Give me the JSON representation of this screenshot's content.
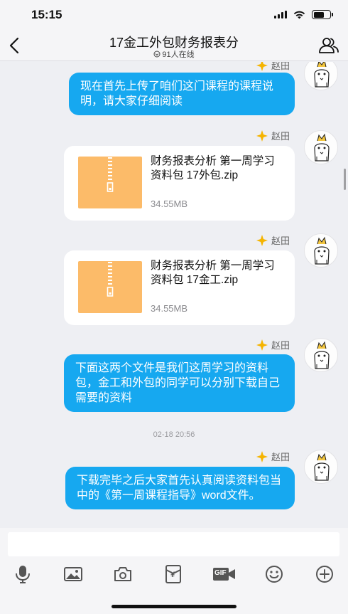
{
  "status": {
    "time": "15:15"
  },
  "header": {
    "title": "17金工外包财务报表分",
    "online": "91人在线"
  },
  "messages": [
    {
      "type": "text",
      "sender": "赵田",
      "text": "现在首先上传了咱们这门课程的课程说明，请大家仔细阅读"
    },
    {
      "type": "file",
      "sender": "赵田",
      "file_name": "财务报表分析 第一周学习资料包 17外包.zip",
      "file_size": "34.55MB"
    },
    {
      "type": "file",
      "sender": "赵田",
      "file_name": "财务报表分析 第一周学习资料包 17金工.zip",
      "file_size": "34.55MB"
    },
    {
      "type": "text",
      "sender": "赵田",
      "text": "下面这两个文件是我们这周学习的资料包，金工和外包的同学可以分别下载自己需要的资料"
    },
    {
      "type": "timestamp",
      "text": "02-18 20:56"
    },
    {
      "type": "text",
      "sender": "赵田",
      "text": "下载完毕之后大家首先认真阅读资料包当中的《第一周课程指导》word文件。"
    }
  ],
  "input": {
    "value": "",
    "placeholder": ""
  },
  "toolbar": {
    "icons": [
      "microphone-icon",
      "image-icon",
      "camera-icon",
      "red-packet-icon",
      "gif-icon",
      "emoji-icon",
      "plus-icon"
    ],
    "gif_label": "GIF",
    "red_packet_label": "¥"
  },
  "colors": {
    "accent": "#16a8f0",
    "file_icon": "#fcbb69",
    "crown": "#f5b400"
  }
}
